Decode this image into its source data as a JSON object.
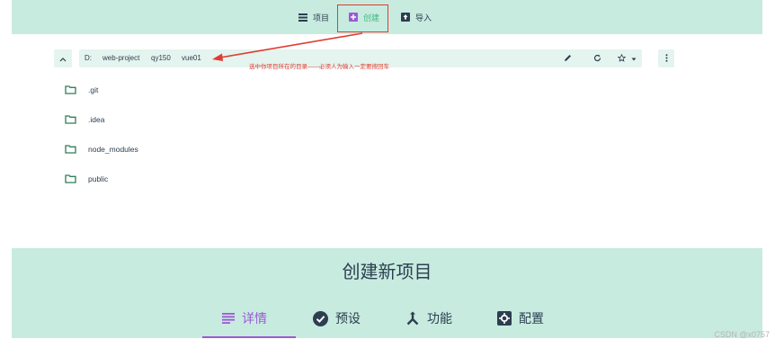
{
  "topnav": {
    "items": [
      {
        "label": "项目",
        "icon": "list-icon"
      },
      {
        "label": "创建",
        "icon": "add-box-icon",
        "active": true
      },
      {
        "label": "导入",
        "icon": "unarchive-icon"
      }
    ]
  },
  "pathbar": {
    "segments": [
      "D:",
      "web-project",
      "qy150",
      "vue01"
    ]
  },
  "annotation": "选中你项目所在的目录——必须人为输入一定要按回车",
  "folders": [
    ".git",
    ".idea",
    "node_modules",
    "public"
  ],
  "page_title": "创建新项目",
  "tabs": [
    {
      "label": "详情",
      "icon": "subject-icon",
      "active": true
    },
    {
      "label": "预设",
      "icon": "check-circle-icon"
    },
    {
      "label": "功能",
      "icon": "call-split-icon"
    },
    {
      "label": "配置",
      "icon": "settings-app-icon"
    }
  ],
  "watermark": "CSDN @x0757",
  "colors": {
    "header_bg": "#c7ebdf",
    "accent_green": "#42b983",
    "accent_purple": "#9b59d6",
    "annotation_red": "#e03c31",
    "text": "#2c3e50"
  }
}
